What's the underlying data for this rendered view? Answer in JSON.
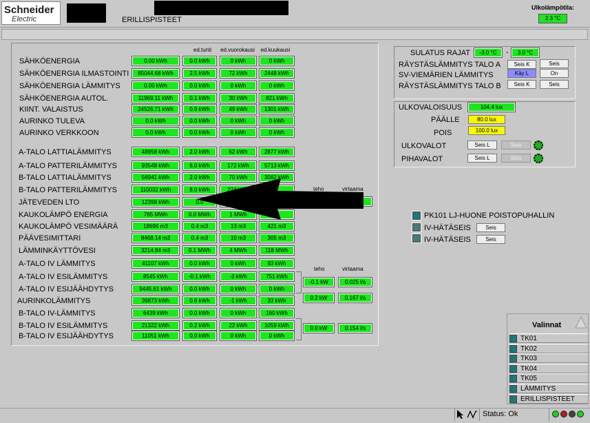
{
  "header": {
    "logo_name": "Schneider",
    "logo_sub": "Electric",
    "title": "ERILLISPISTEET",
    "outdoor_temp_label": "Ulkolämpötila:",
    "outdoor_temp_value": "2.3 °C"
  },
  "table": {
    "col_headers": [
      "ed.tunti",
      "ed.vuorokausi",
      "ed.kuukausi"
    ],
    "rows": [
      {
        "label": "SÄHKÖENERGIA",
        "values": [
          "0.00 kWh",
          "0.0 kWh",
          "0 kWh",
          "0 kWh"
        ]
      },
      {
        "label": "SÄHKÖENERGIA ILMASTOINTI",
        "values": [
          "65044.68 kWh",
          "2.5 kWh",
          "72 kWh",
          "2448 kWh"
        ]
      },
      {
        "label": "SÄHKÖENERGIA LÄMMITYS",
        "values": [
          "0.00 kWh",
          "0.0 kWh",
          "0 kWh",
          "0 kWh"
        ]
      },
      {
        "label": "SÄHKÖENERGIA AUTOL.",
        "values": [
          "11969.11 kWh",
          "0.1 kWh",
          "30 kWh",
          "821 kWh"
        ]
      },
      {
        "label": "KIINT. VALAISTUS",
        "values": [
          "24526.71 kWh",
          "0.9 kWh",
          "49 kWh",
          "1301 kWh"
        ]
      },
      {
        "label": "AURINKO TULEVA",
        "values": [
          "0.0 kWh",
          "0.0 kWh",
          "0 kWh",
          "0 kWh"
        ]
      },
      {
        "label": "AURINKO VERKKOON",
        "values": [
          "0.0 kWh",
          "0.0 kWh",
          "0 kWh",
          "0 kWh"
        ]
      },
      {
        "label": "A-TALO LATTIALÄMMITYS",
        "values": [
          "48958 kWh",
          "2.0 kWh",
          "62 kWh",
          "2877 kWh"
        ]
      },
      {
        "label": "A-TALO PATTERILÄMMITYS",
        "values": [
          "93548 kWh",
          "6.0 kWh",
          "172 kWh",
          "5713 kWh"
        ]
      },
      {
        "label": "B-TALO LATTIALÄMMITYS",
        "values": [
          "56941 kWh",
          "2.0 kWh",
          "70 kWh",
          "3082 kWh"
        ]
      },
      {
        "label": "B-TALO PATTERILÄMMITYS",
        "values": [
          "110032 kWh",
          "8.0 kWh",
          "224 kWh",
          ""
        ]
      },
      {
        "label": "JÄTEVEDEN LTO",
        "values": [
          "12398 kWh",
          "0.0",
          "",
          ""
        ]
      },
      {
        "label": "KAUKOLÄMPÖ ENERGIA",
        "values": [
          "765 MWh",
          "0.0 MWh",
          "1 MWh",
          ""
        ]
      },
      {
        "label": "KAUKOLÄMPÖ VESIMÄÄRÄ",
        "values": [
          "18696 m3",
          "0.4 m3",
          "13 m3",
          "421 m3"
        ]
      },
      {
        "label": "PÄÄVESIMITTARI",
        "values": [
          "8468.14 m3",
          "0.4 m3",
          "10 m3",
          "305 m3"
        ]
      },
      {
        "label": "LÄMMINKÄYTTÖVESI",
        "values": [
          "3214.84 m3",
          "0.1 MWh",
          "4 MWh",
          "118 MWh"
        ]
      },
      {
        "label": "A-TALO IV LÄMMITYS",
        "values": [
          "41107 kWh",
          "0.0 kWh",
          "0 kWh",
          "93 kWh"
        ]
      },
      {
        "label": "A-TALO IV ESILÄMMITYS",
        "values": [
          "8545 kWh",
          "-0.1 kWh",
          "-3 kWh",
          "751 kWh"
        ]
      },
      {
        "label": "A-TALO IV ESIJÄÄHDYTYS",
        "values": [
          "9445.61 kWh",
          "0.0 kWh",
          "0 kWh",
          "0 kWh"
        ]
      },
      {
        "label": "AURINKOLÄMMITYS",
        "values": [
          "39873 kWh",
          "0.6 kWh",
          "-1 kWh",
          "33 kWh"
        ]
      },
      {
        "label": "B-TALO IV-LÄMMITYS",
        "values": [
          "6439 kWh",
          "0.0 kWh",
          "0 kWh",
          "160 kWh"
        ]
      },
      {
        "label": "B-TALO IV ESILÄMMITYS",
        "values": [
          "21322 kWh",
          "0.2 kWh",
          "22 kWh",
          "1059 kWh"
        ]
      },
      {
        "label": "B-TALO IV ESIJÄÄHDYTYS",
        "values": [
          "11051 kWh",
          "0.0 kWh",
          "0 kWh",
          "0 kWh"
        ]
      }
    ],
    "teho_label": "teho",
    "virtaama_label": "virtaama",
    "teho_hidden": "teho",
    "virtaama_hidden": "virtaama",
    "flow_a": {
      "teho": "-0.1 kW",
      "virtaama": "0.025 l/s"
    },
    "flow_aur": {
      "teho": "0.2 kW",
      "virtaama": "0.167 l/s"
    },
    "flow_b": {
      "teho": "0.0 kW",
      "virtaama": "0.154 l/s"
    }
  },
  "right": {
    "sulatus_label": "SULATUS RAJAT",
    "sulatus_low": "-3.0 °C",
    "sulatus_dash": "-",
    "sulatus_high": "3.0 °C",
    "rows": [
      {
        "label": "RÄYSTÄSLÄMMITYS TALO A",
        "btn1": "Seis K",
        "btn2": "Seis"
      },
      {
        "label": "SV-VIEMÄRIEN LÄMMITYS",
        "btn1": "Käy L",
        "btn2": "On"
      },
      {
        "label": "RÄYSTÄSLÄMMITYS TALO B",
        "btn1": "Seis K",
        "btn2": "Seis"
      }
    ],
    "lux_label": "ULKOVALOISUUS",
    "lux_value": "104.4 lux",
    "on_label": "PÄÄLLE",
    "on_value": "80.0 lux",
    "off_label": "POIS",
    "off_value": "100.0 lux",
    "ulkovalot_label": "ULKOVALOT",
    "ulkovalot_btn1": "Seis L",
    "ulkovalot_btn2": "Seis",
    "pihavalot_label": "PIHAVALOT",
    "pihavalot_btn1": "Seis L",
    "pihavalot_btn2": "Seis",
    "pk101_label": "PK101 LJ-HUONE POISTOPUHALLIN",
    "iv1_label": "IV-HÄTÄSEIS",
    "iv1_btn": "Seis",
    "iv2_label": "IV-HÄTÄSEIS",
    "iv2_btn": "Seis"
  },
  "valinnat": {
    "title": "Valinnat",
    "items": [
      "TK01",
      "TK02",
      "TK03",
      "TK04",
      "TK05",
      "LÄMMITYS",
      "ERILLISPISTEET"
    ]
  },
  "status": {
    "text": "Status: Ok",
    "lamp_colors": [
      "#22cc22",
      "#aa2222",
      "#444444",
      "#22cc22"
    ]
  },
  "colors": {
    "green": "#1ee61e",
    "yellow": "#f8f800",
    "blue": "#8c8cff"
  }
}
